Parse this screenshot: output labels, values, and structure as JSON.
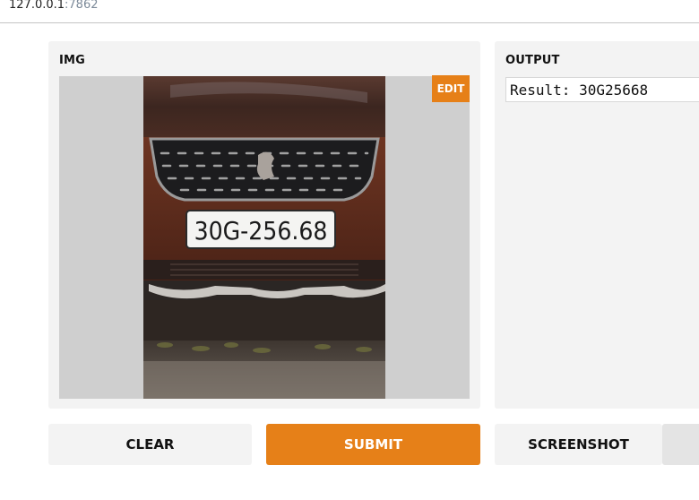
{
  "browser": {
    "url_host": "127.0.0.1",
    "url_port": ":7862"
  },
  "input_panel": {
    "label": "IMG",
    "edit_label": "EDIT"
  },
  "photo": {
    "plate_text": "30G-256.68"
  },
  "output_panel": {
    "label": "OUTPUT",
    "result": "Result: 30G25668"
  },
  "buttons": {
    "clear": "CLEAR",
    "submit": "SUBMIT",
    "screenshot": "SCREENSHOT"
  },
  "colors": {
    "accent": "#e68018",
    "panel_bg": "#f3f3f3",
    "image_bg": "#cfcfcf"
  }
}
